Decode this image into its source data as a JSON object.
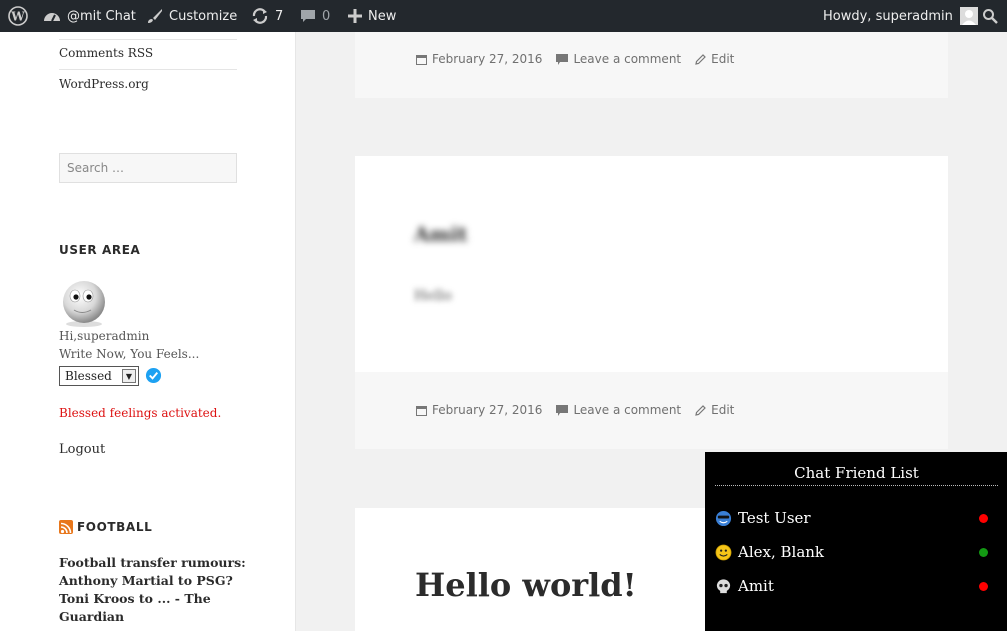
{
  "adminbar": {
    "site_name": "@mit Chat",
    "customize": "Customize",
    "updates_count": "7",
    "comments_count": "0",
    "new_label": "New",
    "howdy": "Howdy, superadmin"
  },
  "sidebar": {
    "links": [
      "Comments RSS",
      "WordPress.org"
    ],
    "search_placeholder": "Search …",
    "user_area_title": "USER AREA",
    "greeting": "Hi,superadmin",
    "prompt": "Write Now, You Feels...",
    "feeling_value": "Blessed",
    "activated": "Blessed feelings activated.",
    "logout": "Logout",
    "football_title": "FOOTBALL",
    "football_news": "Football transfer rumours: Anthony Martial to PSG? Toni Kroos to ... - The Guardian"
  },
  "posts": [
    {
      "date": "February 27, 2016",
      "comment": "Leave a comment",
      "edit": "Edit"
    },
    {
      "title": "Amit",
      "excerpt": "Hello",
      "date": "February 27, 2016",
      "comment": "Leave a comment",
      "edit": "Edit"
    },
    {
      "title": "Hello world!"
    }
  ],
  "chat": {
    "title": "Chat Friend List",
    "friends": [
      {
        "name": "Test User",
        "status_color": "#ff0000"
      },
      {
        "name": "Alex, Blank",
        "status_color": "#139a13"
      },
      {
        "name": "Amit",
        "status_color": "#ff0000"
      }
    ]
  },
  "colors": {
    "adminbar": "#23282d",
    "alert": "#dd1111",
    "chat_bg": "#000000"
  }
}
